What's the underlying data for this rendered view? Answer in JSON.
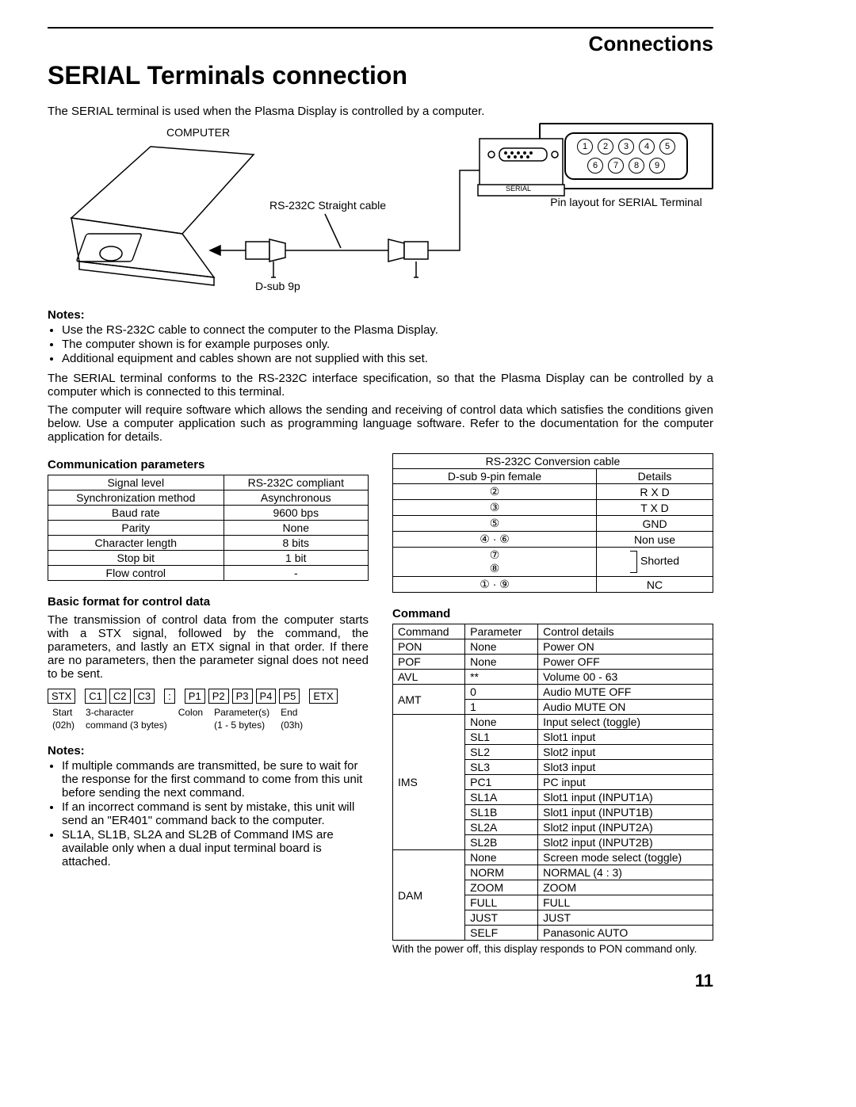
{
  "header": {
    "section": "Connections",
    "title": "SERIAL Terminals connection"
  },
  "lead": "The SERIAL terminal is used when the Plasma Display is controlled by a computer.",
  "diagram": {
    "computer": "COMPUTER",
    "cable": "RS-232C Straight cable",
    "dsub": "D-sub 9p",
    "serial": "SERIAL",
    "pin_caption": "Pin layout for SERIAL Terminal",
    "pins_top": [
      "1",
      "2",
      "3",
      "4",
      "5"
    ],
    "pins_bottom": [
      "6",
      "7",
      "8",
      "9"
    ]
  },
  "notes1_h": "Notes:",
  "notes1": [
    "Use the RS-232C cable to connect the computer to the Plasma Display.",
    "The computer shown is for example purposes only.",
    "Additional equipment and cables shown are not supplied with this set."
  ],
  "para1": "The SERIAL terminal conforms to the RS-232C interface specification, so that the Plasma Display can be controlled by a computer which is connected to this terminal.",
  "para2": "The computer will require software which allows the sending and receiving of control data which satisfies the conditions given below. Use a computer application such as programming language software. Refer to the documentation for the computer application for details.",
  "comm_params_h": "Communication parameters",
  "comm_params": [
    {
      "k": "Signal level",
      "v": "RS-232C compliant"
    },
    {
      "k": "Synchronization method",
      "v": "Asynchronous"
    },
    {
      "k": "Baud rate",
      "v": "9600 bps"
    },
    {
      "k": "Parity",
      "v": "None"
    },
    {
      "k": "Character length",
      "v": "8 bits"
    },
    {
      "k": "Stop bit",
      "v": "1 bit"
    },
    {
      "k": "Flow control",
      "v": "-"
    }
  ],
  "conversion_h": "RS-232C Conversion cable",
  "conversion_cols": {
    "c1": "D-sub 9-pin female",
    "c2": "Details"
  },
  "conversion_rows": [
    {
      "pin": "②",
      "d": "R X D"
    },
    {
      "pin": "③",
      "d": "T X D"
    },
    {
      "pin": "⑤",
      "d": "GND"
    },
    {
      "pin": "④ · ⑥",
      "d": "Non use"
    },
    {
      "pin": "⑦\n⑧",
      "d": "Shorted",
      "bracket": true
    },
    {
      "pin": "① · ⑨",
      "d": "NC"
    }
  ],
  "basic_format_h": "Basic format for control data",
  "basic_format_p": "The transmission of control data from the computer starts with a STX signal, followed by the command, the parameters, and lastly an ETX signal in that order. If there are no parameters, then the parameter signal does not need to be sent.",
  "format": {
    "stx": "STX",
    "c1": "C1",
    "c2": "C2",
    "c3": "C3",
    "colon": ":",
    "p1": "P1",
    "p2": "P2",
    "p3": "P3",
    "p4": "P4",
    "p5": "P5",
    "etx": "ETX",
    "l_start": "Start",
    "l_starth": "(02h)",
    "l_cmd": "3-character",
    "l_cmd2": "command (3 bytes)",
    "l_colon": "Colon",
    "l_param": "Parameter(s)",
    "l_param2": "(1 - 5 bytes)",
    "l_end": "End",
    "l_end2": "(03h)"
  },
  "notes2_h": "Notes:",
  "notes2": [
    "If multiple commands are transmitted, be sure to wait for the response for the first command to come from this unit before sending the next command.",
    "If an incorrect command is sent by mistake, this unit will send an \"ER401\" command back to the computer.",
    "SL1A, SL1B, SL2A and SL2B of Command IMS are available only when a dual input terminal board is attached."
  ],
  "command_h": "Command",
  "command_cols": {
    "c1": "Command",
    "c2": "Parameter",
    "c3": "Control details"
  },
  "commands": [
    {
      "cmd": "PON",
      "rows": [
        {
          "p": "None",
          "d": "Power ON"
        }
      ]
    },
    {
      "cmd": "POF",
      "rows": [
        {
          "p": "None",
          "d": "Power OFF"
        }
      ]
    },
    {
      "cmd": "AVL",
      "rows": [
        {
          "p": "**",
          "d": "Volume 00 - 63"
        }
      ]
    },
    {
      "cmd": "AMT",
      "rows": [
        {
          "p": "0",
          "d": "Audio MUTE OFF"
        },
        {
          "p": "1",
          "d": "Audio MUTE ON"
        }
      ]
    },
    {
      "cmd": "IMS",
      "rows": [
        {
          "p": "None",
          "d": "Input select (toggle)"
        },
        {
          "p": "SL1",
          "d": "Slot1 input"
        },
        {
          "p": "SL2",
          "d": "Slot2 input"
        },
        {
          "p": "SL3",
          "d": "Slot3 input"
        },
        {
          "p": "PC1",
          "d": "PC input"
        },
        {
          "p": "SL1A",
          "d": "Slot1 input (INPUT1A)"
        },
        {
          "p": "SL1B",
          "d": "Slot1 input (INPUT1B)"
        },
        {
          "p": "SL2A",
          "d": "Slot2 input (INPUT2A)"
        },
        {
          "p": "SL2B",
          "d": "Slot2 input (INPUT2B)"
        }
      ]
    },
    {
      "cmd": "DAM",
      "rows": [
        {
          "p": "None",
          "d": "Screen mode select (toggle)"
        },
        {
          "p": "NORM",
          "d": "NORMAL (4 : 3)"
        },
        {
          "p": "ZOOM",
          "d": "ZOOM"
        },
        {
          "p": "FULL",
          "d": "FULL"
        },
        {
          "p": "JUST",
          "d": "JUST"
        },
        {
          "p": "SELF",
          "d": "Panasonic AUTO"
        }
      ]
    }
  ],
  "command_footnote": "With the power off, this display responds to PON command only.",
  "page_number": "11"
}
